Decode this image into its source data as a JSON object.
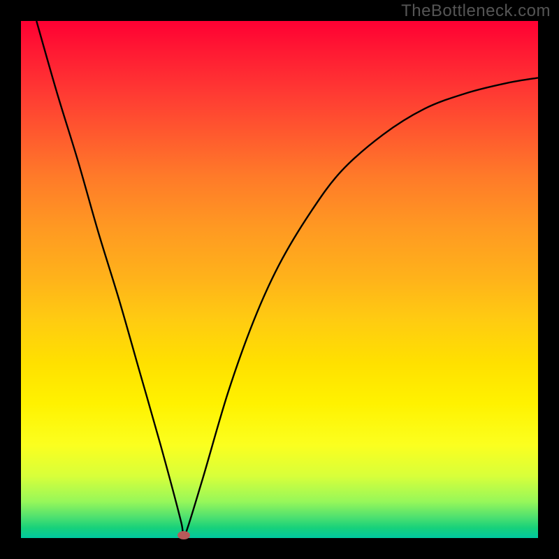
{
  "watermark": "TheBottleneck.com",
  "chart_data": {
    "type": "line",
    "title": "",
    "xlabel": "",
    "ylabel": "",
    "xlim": [
      0,
      1
    ],
    "ylim": [
      0,
      1
    ],
    "series": [
      {
        "name": "bottleneck-curve",
        "x": [
          0.03,
          0.07,
          0.11,
          0.15,
          0.19,
          0.23,
          0.27,
          0.31,
          0.315,
          0.35,
          0.4,
          0.45,
          0.5,
          0.56,
          0.62,
          0.7,
          0.78,
          0.86,
          0.94,
          1.0
        ],
        "values": [
          1.0,
          0.86,
          0.73,
          0.59,
          0.46,
          0.32,
          0.18,
          0.03,
          0.0,
          0.11,
          0.28,
          0.42,
          0.53,
          0.63,
          0.71,
          0.78,
          0.83,
          0.86,
          0.88,
          0.89
        ]
      }
    ],
    "annotations": [
      {
        "name": "minimum-marker",
        "x": 0.315,
        "y": 0.0
      }
    ],
    "background_gradient": {
      "top": "#ff0033",
      "mid1": "#ff9922",
      "mid2": "#fff200",
      "bottom": "#00c8a0"
    },
    "colors": {
      "curve": "#000000",
      "marker": "#b85a5a",
      "frame": "#000000"
    }
  }
}
